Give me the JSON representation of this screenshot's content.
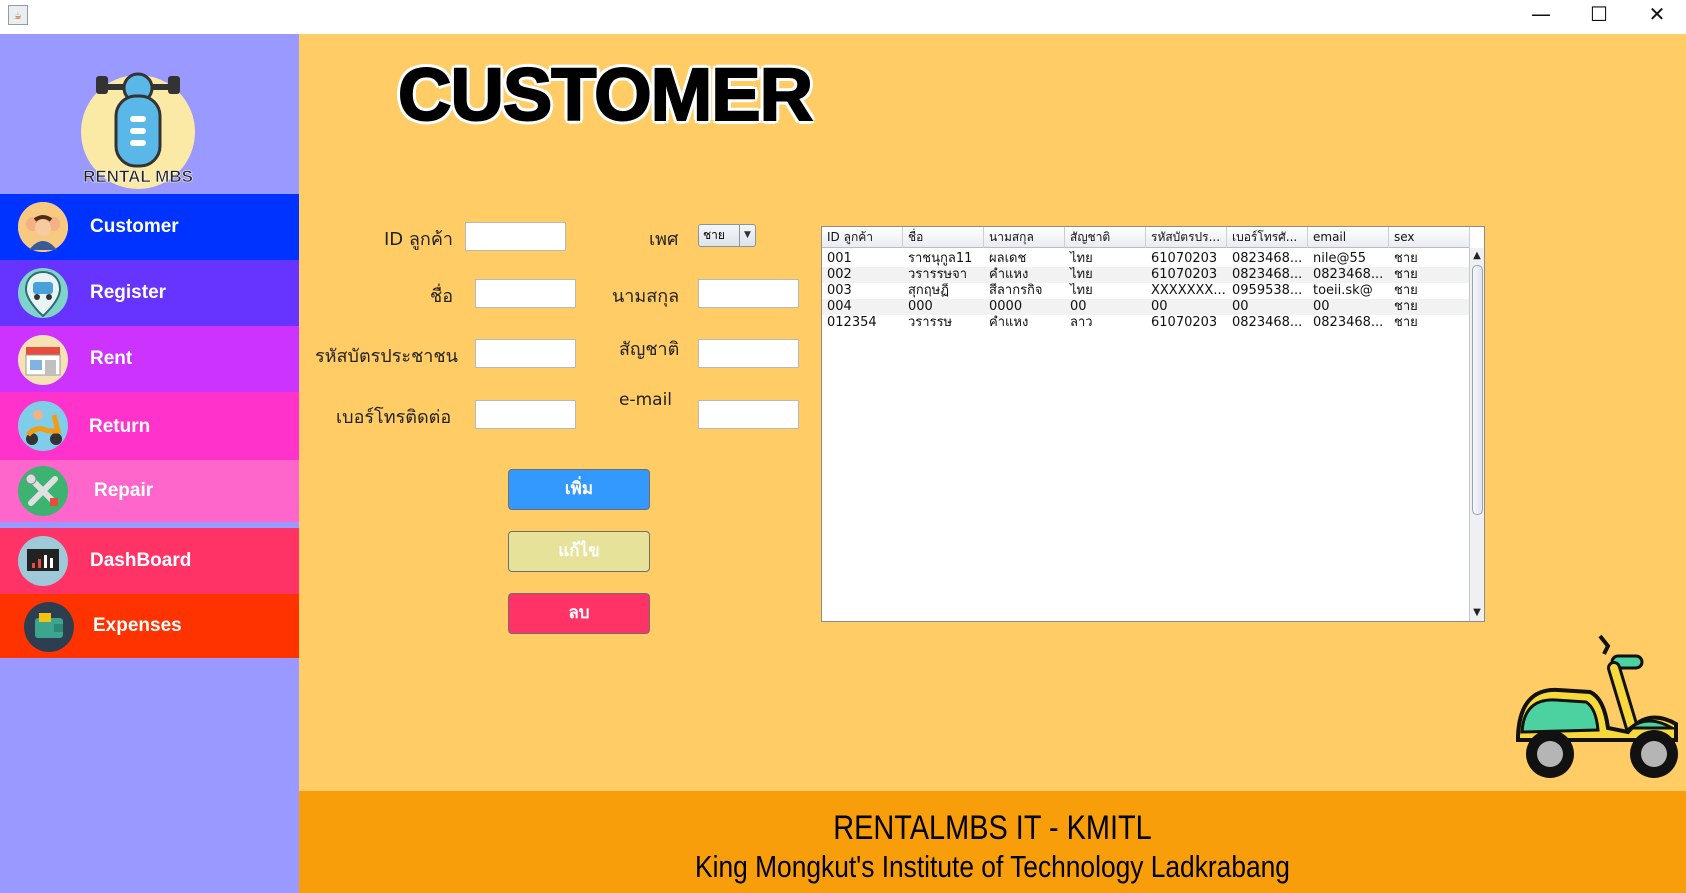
{
  "window": {
    "icon": "java-icon",
    "controls": {
      "minimize": "—",
      "maximize": "☐",
      "close": "✕"
    }
  },
  "sidebar": {
    "logo_text": "RENTAL MBS",
    "items": [
      {
        "label": "Customer",
        "icon": "customers-icon",
        "color": "#0033ff"
      },
      {
        "label": "Register",
        "icon": "bike-register-icon",
        "color": "#6633ff"
      },
      {
        "label": "Rent",
        "icon": "shop-icon",
        "color": "#cc33ff"
      },
      {
        "label": "Return",
        "icon": "scooter-return-icon",
        "color": "#ff33cc"
      },
      {
        "label": "Repair",
        "icon": "tools-icon",
        "color": "#ff66cc"
      },
      {
        "label": "DashBoard",
        "icon": "chart-icon",
        "color": "#ff3366"
      },
      {
        "label": "Expenses",
        "icon": "wallet-icon",
        "color": "#ff3300"
      }
    ]
  },
  "page": {
    "title": "CUSTOMER"
  },
  "form": {
    "id_label": "ID ลูกค้า",
    "id_value": "",
    "gender_label": "เพศ",
    "gender_value": "ชาย",
    "name_label": "ชื่อ",
    "name_value": "",
    "surname_label": "นามสกุล",
    "surname_value": "",
    "citizen_label": "รหัสบัตรประชาชน",
    "citizen_value": "",
    "nationality_label": "สัญชาติ",
    "nationality_value": "",
    "phone_label": "เบอร์โทรติดต่อ",
    "phone_value": "",
    "email_label": "e-mail",
    "email_value": ""
  },
  "buttons": {
    "add": "เพิ่ม",
    "edit": "แก้ไข",
    "delete": "ลบ",
    "add_color": "#3399ff",
    "edit_color": "#e6e29a",
    "delete_color": "#ff3366"
  },
  "table": {
    "columns": [
      "ID ลูกค้า",
      "ชื่อ",
      "นามสกุล",
      "สัญชาติ",
      "รหัสบัตรปร...",
      "เบอร์โทรศั...",
      "email",
      "sex"
    ],
    "rows": [
      [
        "001",
        "ราชนุกูล11",
        "ผลเดช",
        "ไทย",
        "61070203",
        "0823468...",
        "nile@55",
        "ชาย"
      ],
      [
        "002",
        "วรารรษจา",
        "คำแหง",
        "ไทย",
        "61070203",
        "0823468...",
        "0823468...",
        "ชาย"
      ],
      [
        "003",
        "สุกฤษฏิ์",
        "สีลากรกิจ",
        "ไทย",
        "XXXXXXX...",
        "0959538...",
        "toeii.sk@",
        "ชาย"
      ],
      [
        "004",
        "000",
        "0000",
        "00",
        "00",
        "00",
        "00",
        "ชาย"
      ],
      [
        "012354",
        "วรารรษ",
        "คำแหง",
        "ลาว",
        "61070203",
        "0823468...",
        "0823468...",
        "ชาย"
      ]
    ]
  },
  "footer": {
    "line1": "RENTALMBS IT - KMITL",
    "line2": "King Mongkut's Institute of  Technology Ladkrabang"
  },
  "colors": {
    "sidebar_bg": "#9999ff",
    "main_bg": "#ffcc66",
    "footer_bg": "#f89e0a"
  }
}
